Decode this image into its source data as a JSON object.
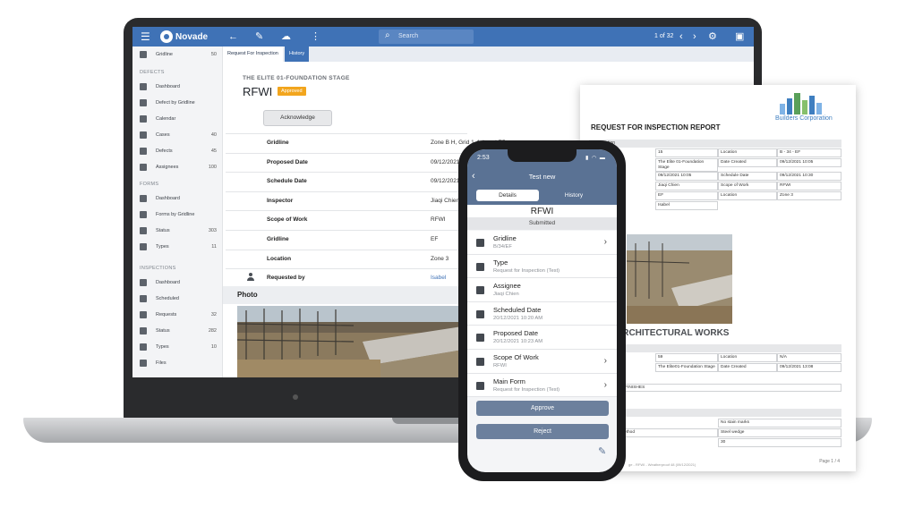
{
  "app": {
    "brand": "Novade",
    "search_placeholder": "Search",
    "pager": "1 of 32",
    "menu_icon": "hamburger-icon",
    "back_icon": "arrow-left-icon",
    "edit_icon": "pencil-icon",
    "cloud_icon": "cloud-upload-icon",
    "more_icon": "more-vert-icon",
    "settings_icon": "gear-icon",
    "profile_icon": "person-box-icon",
    "accent": "#3f72b6"
  },
  "sidebar": {
    "top_item": {
      "label": "Gridline",
      "count": "50"
    },
    "sections": [
      {
        "title": "DEFECTS",
        "items": [
          {
            "label": "Dashboard",
            "count": ""
          },
          {
            "label": "Defect by Gridline",
            "count": ""
          },
          {
            "label": "Calendar",
            "count": ""
          },
          {
            "label": "Cases",
            "count": "40"
          },
          {
            "label": "Defects",
            "count": "45"
          },
          {
            "label": "Assignees",
            "count": "100"
          }
        ]
      },
      {
        "title": "FORMS",
        "items": [
          {
            "label": "Dashboard",
            "count": ""
          },
          {
            "label": "Forms by Gridline",
            "count": ""
          },
          {
            "label": "Status",
            "count": "303"
          },
          {
            "label": "Types",
            "count": "11"
          }
        ]
      },
      {
        "title": "INSPECTIONS",
        "items": [
          {
            "label": "Dashboard",
            "count": ""
          },
          {
            "label": "Scheduled",
            "count": ""
          },
          {
            "label": "Requests",
            "count": "32"
          },
          {
            "label": "Status",
            "count": "282"
          },
          {
            "label": "Types",
            "count": "10"
          },
          {
            "label": "Files",
            "count": ""
          }
        ]
      }
    ]
  },
  "tabs": [
    {
      "label": "Request For Inspection"
    },
    {
      "label": "History"
    }
  ],
  "form": {
    "eyebrow": "THE ELITE 01-FOUNDATION STAGE",
    "title": "RFWI",
    "status": "Approved",
    "acknowledge_label": "Acknowledge",
    "rows": [
      {
        "label": "Gridline",
        "value": "Zone B H, Grid 1-4, Level E5"
      },
      {
        "label": "Proposed Date",
        "value": "09/12/2021"
      },
      {
        "label": "Schedule Date",
        "value": "09/12/2021"
      },
      {
        "label": "Inspector",
        "value": "Jiaqi Chien"
      },
      {
        "label": "Scope of Work",
        "value": "RFWI"
      },
      {
        "label": "Gridline",
        "value": "EF"
      },
      {
        "label": "Location",
        "value": "Zone 3"
      },
      {
        "label": "Requested by",
        "value": "Isabel"
      }
    ],
    "photo_label": "Photo"
  },
  "report": {
    "company": "Builders Corporation",
    "title": "REQUEST FOR INSPECTION REPORT",
    "section1": "Information",
    "cells": [
      {
        "k": "",
        "v": "15",
        "k2": "Location",
        "v2": "B - 34 - EF"
      },
      {
        "k": "",
        "v": "The Elite 01-Foundation Stage",
        "k2": "Date Created",
        "v2": "09/12/2021 10:05"
      },
      {
        "k": "",
        "v": "09/12/2021 10:05",
        "k2": "Schedule Date",
        "v2": "09/12/2021 10:30"
      },
      {
        "k": "",
        "v": "Jiaqi Chien",
        "k2": "Scope of Work",
        "v2": "RFWI"
      },
      {
        "k": "",
        "v": "EF",
        "k2": "Location",
        "v2": "Zone 3"
      },
      {
        "k": "",
        "v": "Isabel",
        "k2": "",
        "v2": ""
      }
    ],
    "heading2": "ARCHITECTURAL WORKS",
    "section2": "tion",
    "cells2": [
      {
        "k": "",
        "v": "59",
        "k2": "Location",
        "v2": "N/A"
      },
      {
        "k": "",
        "v": "The Elite01-Foundation Stage",
        "k2": "Date Created",
        "v2": "09/12/2021 13:08"
      }
    ],
    "finishes": "ERNAL FINISHES",
    "requirements": "quirements",
    "req_rows": [
      {
        "k": "",
        "v": "No stain marks"
      },
      {
        "k": "ethod",
        "v": "Steel wedge"
      },
      {
        "k": "",
        "v": "30"
      }
    ],
    "footer_left": "ge - RFWI - Weatherproof 48 (09/12/2021)",
    "footer": "Page 1 / 4"
  },
  "phone": {
    "time": "2:53",
    "status_icons": "▮ ◠ ▬",
    "header_title": "Test new",
    "seg_details": "Details",
    "seg_history": "History",
    "form_name": "RFWI",
    "status": "Submitted",
    "rows": [
      {
        "label": "Gridline",
        "sub": "B/34/EF",
        "chevron": true,
        "icon": "layers-icon"
      },
      {
        "label": "Type",
        "sub": "Request for Inspection (Test)",
        "chevron": false,
        "icon": "folder-icon"
      },
      {
        "label": "Assignee",
        "sub": "Jiaqi Chien",
        "chevron": false,
        "icon": "people-icon"
      },
      {
        "label": "Scheduled Date",
        "sub": "20/12/2021 10:20 AM",
        "chevron": false,
        "icon": "calendar-icon"
      },
      {
        "label": "Proposed Date",
        "sub": "20/12/2021 10:23 AM",
        "chevron": false,
        "icon": "calendar-icon"
      },
      {
        "label": "Scope Of Work",
        "sub": "RFWI",
        "chevron": true,
        "icon": "folder-icon"
      },
      {
        "label": "Main Form",
        "sub": "Request for Inspection (Test)",
        "chevron": true,
        "icon": "document-icon"
      }
    ],
    "approve_label": "Approve",
    "reject_label": "Reject"
  }
}
